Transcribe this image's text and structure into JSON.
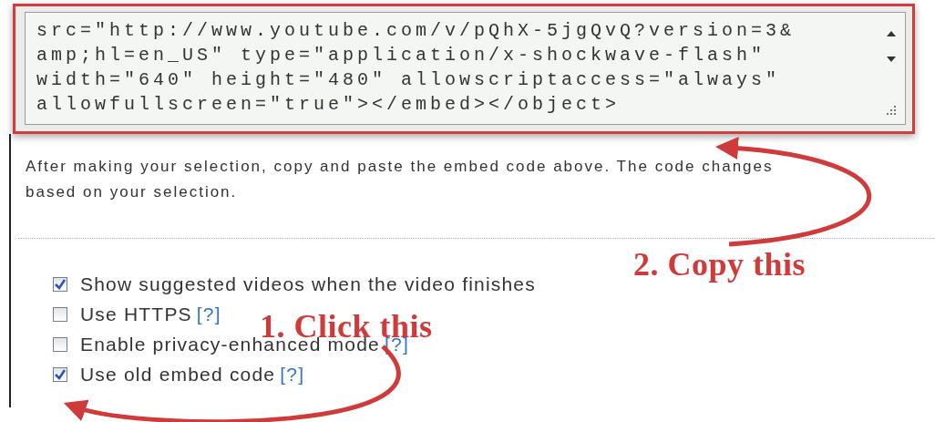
{
  "embed_code": {
    "lines": [
      "src=\"http://www.youtube.com/v/pQhX-5jgQvQ?version=3&",
      "amp;hl=en_US\" type=\"application/x-shockwave-flash\"",
      "width=\"640\" height=\"480\" allowscriptaccess=\"always\"",
      "allowfullscreen=\"true\"></embed></object>"
    ]
  },
  "instructions": "After making your selection, copy and paste the embed code above. The code changes based on your selection.",
  "options": [
    {
      "label": "Show suggested videos when the video finishes",
      "checked": true
    },
    {
      "label": "Use HTTPS",
      "help": "[?]",
      "checked": false
    },
    {
      "label": "Enable privacy-enhanced mode",
      "help": "[?]",
      "checked": false
    },
    {
      "label": "Use old embed code",
      "help": "[?]",
      "checked": true
    }
  ],
  "annotations": [
    {
      "text": "2. Copy this"
    },
    {
      "text": "1. Click this"
    }
  ]
}
